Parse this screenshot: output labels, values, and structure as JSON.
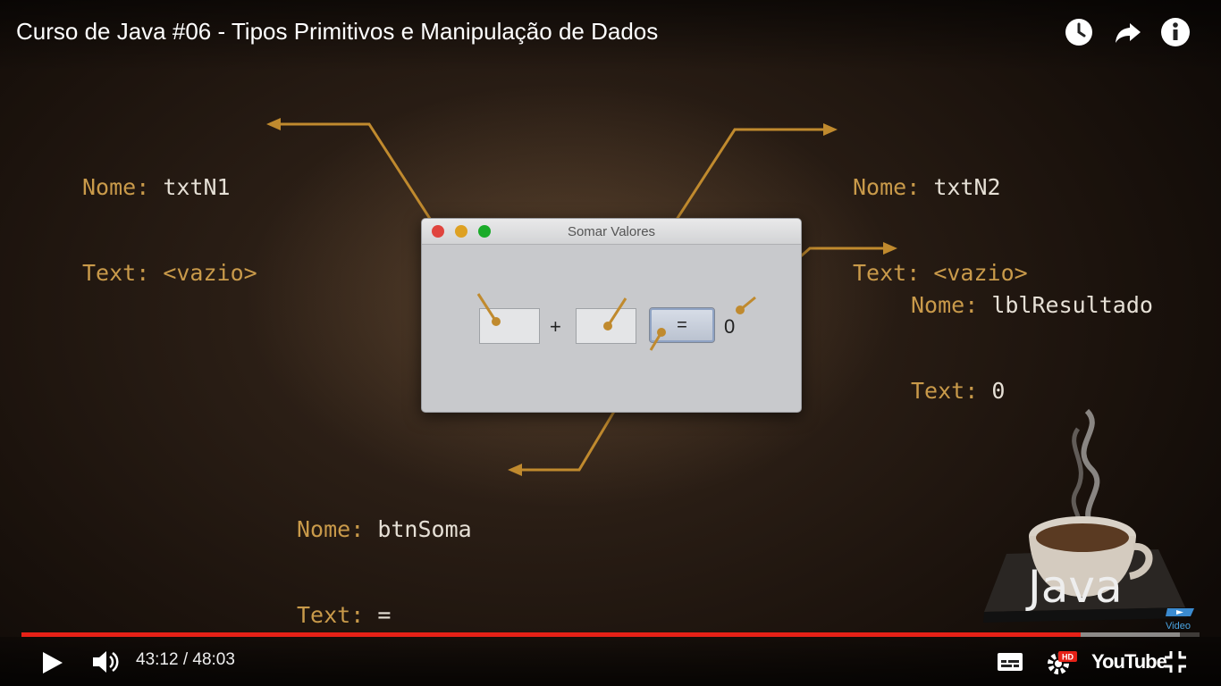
{
  "video": {
    "title": "Curso de Java #06 - Tipos Primitivos e Manipulação de Dados"
  },
  "top_icons": [
    "watch-later-icon",
    "share-icon",
    "info-icon"
  ],
  "annotations": {
    "txtN1": {
      "nome_key": "Nome:",
      "nome_value": "txtN1",
      "text_key": "Text:",
      "text_value": "<vazio>"
    },
    "txtN2": {
      "nome_key": "Nome:",
      "nome_value": "txtN2",
      "text_key": "Text:",
      "text_value": "<vazio>"
    },
    "lblResultado": {
      "nome_key": "Nome:",
      "nome_value": "lblResultado",
      "text_key": "Text:",
      "text_value": "0"
    },
    "btnSoma": {
      "nome_key": "Nome:",
      "nome_value": "btnSoma",
      "text_key": "Text:",
      "text_value": "="
    }
  },
  "app_window": {
    "title": "Somar Valores",
    "plus": "+",
    "button_label": "=",
    "result": "0"
  },
  "logo": {
    "text": "Java",
    "badge": "Video"
  },
  "player": {
    "current_time": "43:12",
    "separator": "/",
    "duration": "48:03",
    "time_display": "43:12 / 48:03",
    "played_fraction": 0.8994,
    "loaded_fraction": 0.9833,
    "hd_badge": "HD",
    "brand": "YouTube",
    "progress_color": "#e62117"
  },
  "colors": {
    "annotation_key": "#c99a4a",
    "annotation_value": "#e6e0d6",
    "callout_line": "#c08a2e"
  }
}
